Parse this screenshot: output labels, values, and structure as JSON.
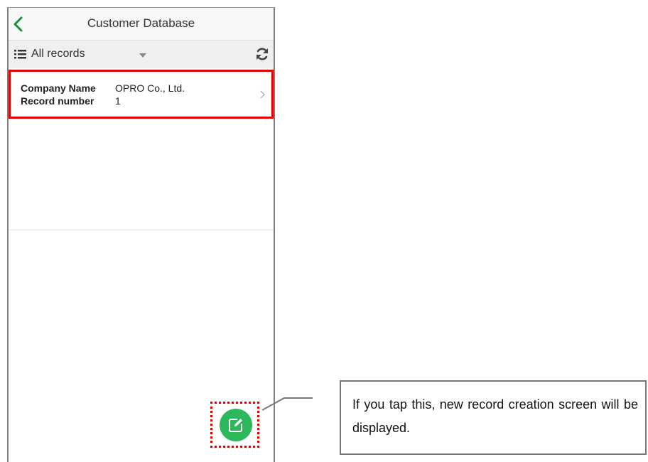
{
  "header": {
    "title": "Customer Database"
  },
  "filter_bar": {
    "view_label": "All records"
  },
  "record": {
    "fields": [
      {
        "label": "Company Name",
        "value": "OPRO Co., Ltd."
      },
      {
        "label": "Record number",
        "value": "1"
      }
    ]
  },
  "callout": {
    "text": "If you tap this, new record creation screen will be displayed."
  },
  "icons": {
    "back": "chevron-left-icon",
    "list": "list-icon",
    "dropdown": "caret-down-icon",
    "refresh": "refresh-icon",
    "row_chevron": "chevron-right-icon",
    "new_record": "edit-icon"
  },
  "colors": {
    "accent_green": "#2eb85c",
    "highlight_red": "#e00000",
    "back_green": "#1a8a3c"
  }
}
